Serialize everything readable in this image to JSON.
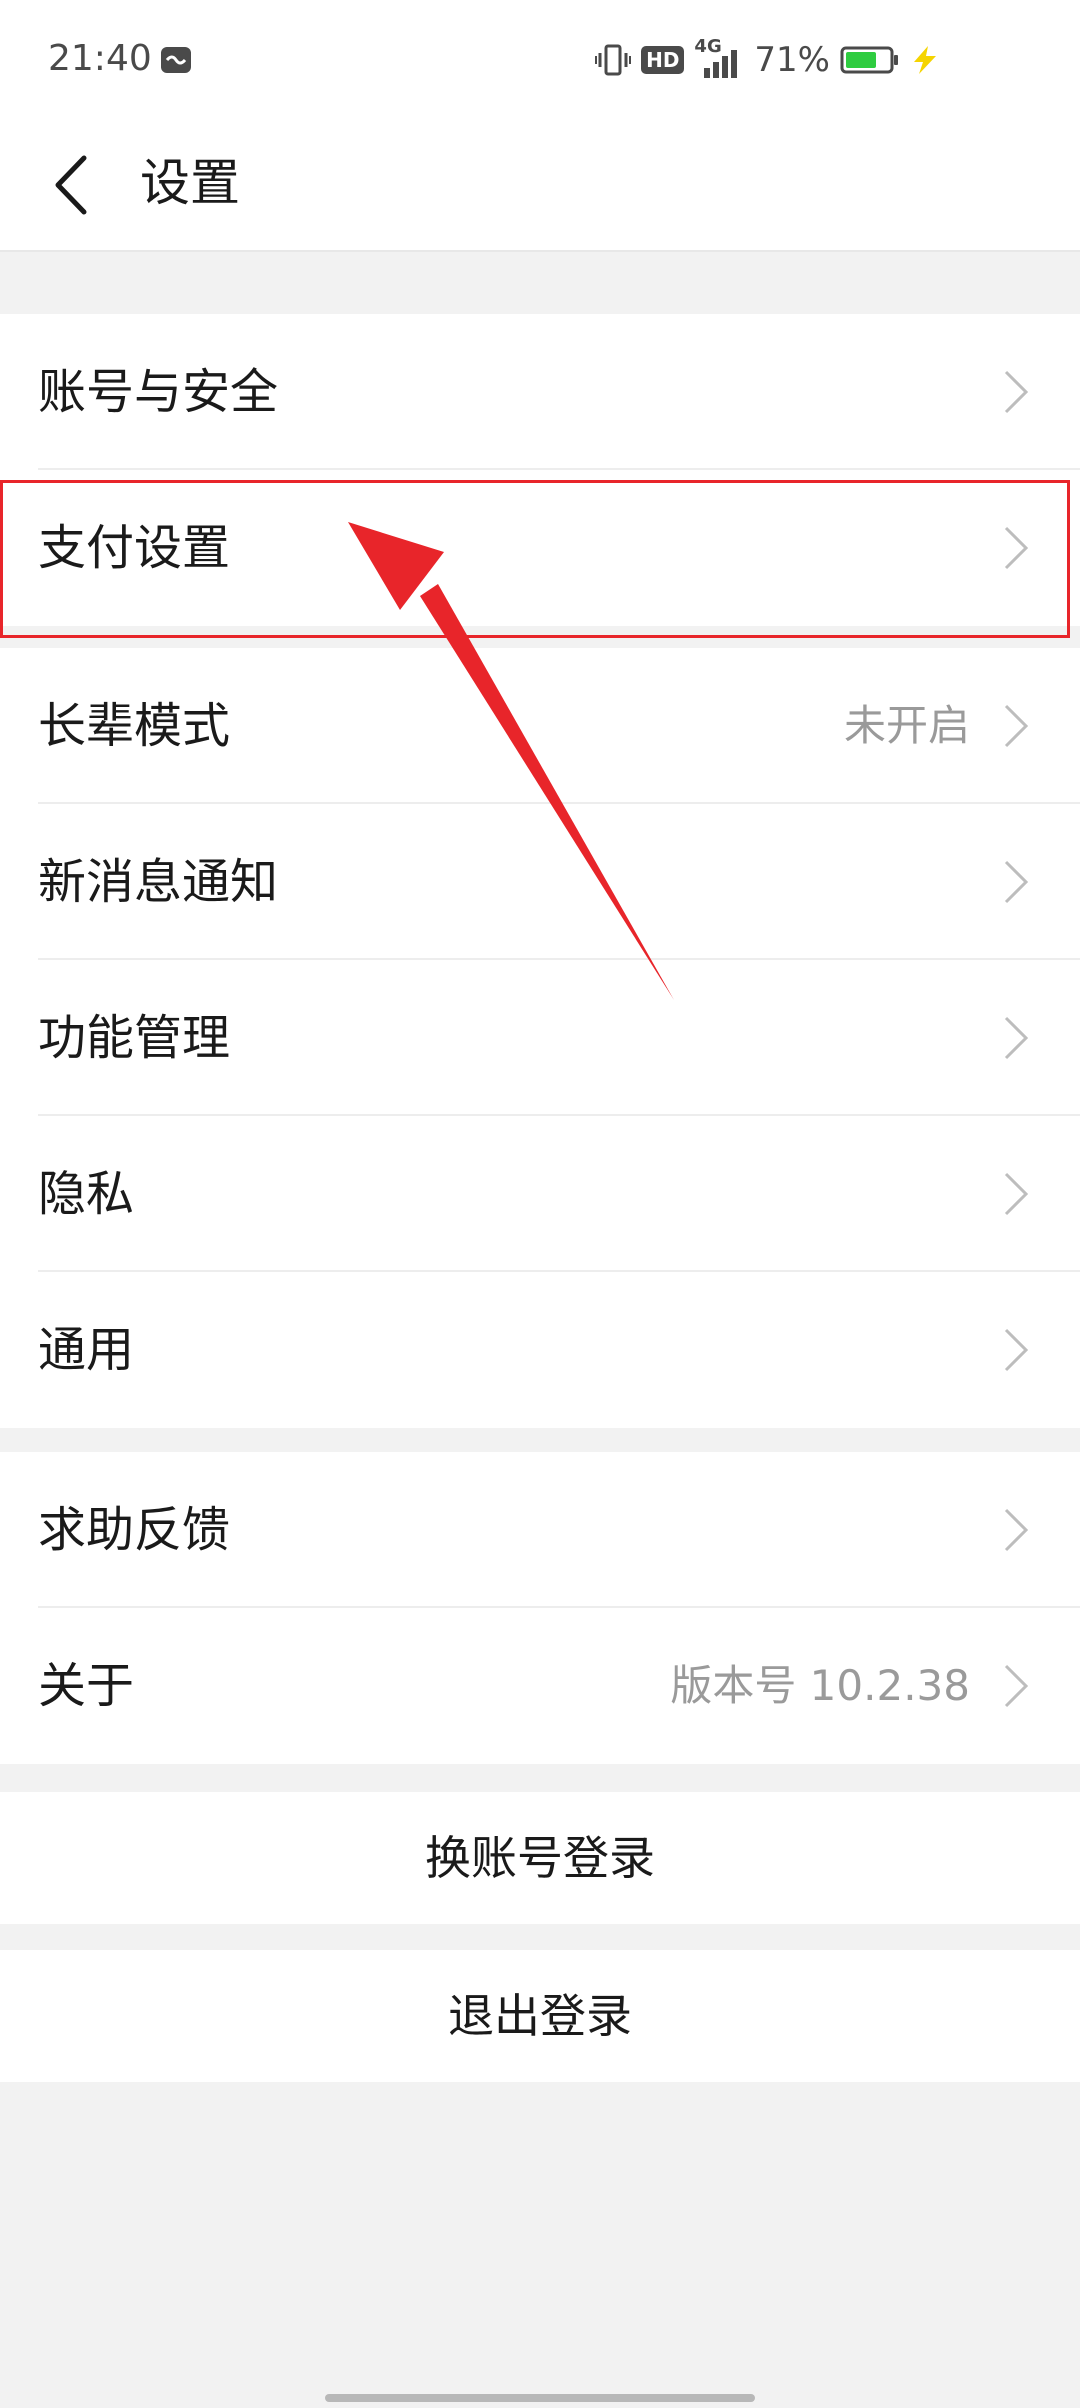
{
  "status_bar": {
    "time": "21:40",
    "battery_percent": "71%",
    "battery_level": 0.71,
    "network": "4G",
    "hd_label": "HD"
  },
  "nav": {
    "title": "设置",
    "back_icon": "chevron-left-icon"
  },
  "groups": [
    {
      "items": [
        {
          "label": "账号与安全",
          "value": ""
        },
        {
          "label": "支付设置",
          "value": ""
        }
      ]
    },
    {
      "items": [
        {
          "label": "长辈模式",
          "value": "未开启"
        },
        {
          "label": "新消息通知",
          "value": ""
        },
        {
          "label": "功能管理",
          "value": ""
        },
        {
          "label": "隐私",
          "value": ""
        },
        {
          "label": "通用",
          "value": ""
        }
      ]
    },
    {
      "items": [
        {
          "label": "求助反馈",
          "value": ""
        },
        {
          "label": "关于",
          "value": "版本号 10.2.38"
        }
      ]
    }
  ],
  "actions": {
    "switch_account": "换账号登录",
    "logout": "退出登录"
  },
  "colors": {
    "highlight": "#e8252a",
    "battery": "#2ecc40",
    "charging": "#f5d400",
    "background": "#f2f2f2"
  }
}
